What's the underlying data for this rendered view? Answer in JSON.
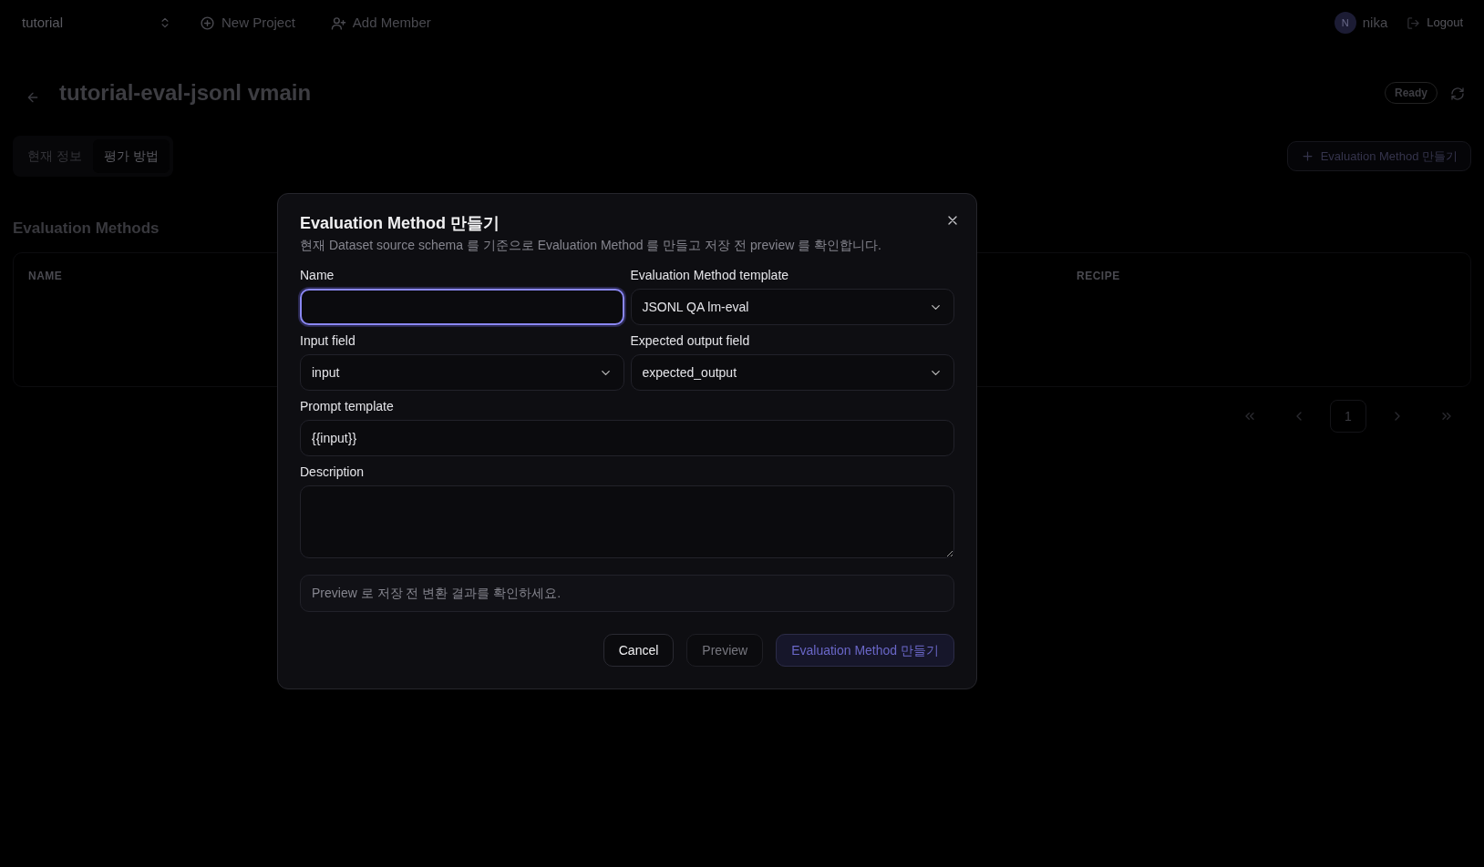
{
  "topbar": {
    "project_select": "tutorial",
    "actions": [
      {
        "label": "New Project",
        "kind": "new"
      },
      {
        "label": "Add Member",
        "kind": "member"
      }
    ],
    "user": {
      "initial": "N",
      "name": "nika"
    },
    "logout": "Logout"
  },
  "header": {
    "title": "tutorial-eval-jsonl vmain",
    "status": "Ready"
  },
  "tabs": [
    {
      "label": "현재 정보",
      "selected": false
    },
    {
      "label": "평가 방법",
      "selected": true
    }
  ],
  "create_button": "Evaluation Method 만들기",
  "section_title": "Evaluation Methods",
  "table": {
    "columns": [
      "NAME",
      "RECIPE"
    ]
  },
  "pagination": {
    "pages": [
      {
        "label": "1",
        "selected": true
      }
    ]
  },
  "dialog": {
    "title": "Evaluation Method 만들기",
    "description": "현재 Dataset source schema 를 기준으로 Evaluation Method 를 만들고 저장 전 preview 를 확인합니다.",
    "rows": [
      [
        {
          "label": "Name",
          "kind": "text",
          "focused": true
        },
        {
          "label": "Evaluation Method template",
          "kind": "select",
          "value": "JSONL QA lm-eval",
          "focused": false
        }
      ],
      [
        {
          "label": "Input field",
          "kind": "select",
          "value": "input",
          "focused": false
        },
        {
          "label": "Expected output field",
          "kind": "select",
          "value": "expected_output",
          "focused": false
        }
      ],
      [
        {
          "label": "Prompt template",
          "kind": "text",
          "value": "{{input}}",
          "focused": false
        }
      ],
      [
        {
          "label": "Description",
          "kind": "textarea",
          "focused": false
        }
      ]
    ],
    "preview_note": "Preview 로 저장 전 변환 결과를 확인하세요.",
    "buttons": [
      {
        "label": "Cancel",
        "kind": "outline",
        "disabled": false
      },
      {
        "label": "Preview",
        "kind": "outline",
        "disabled": true
      },
      {
        "label": "Evaluation Method 만들기",
        "kind": "primary",
        "disabled": true
      }
    ]
  }
}
